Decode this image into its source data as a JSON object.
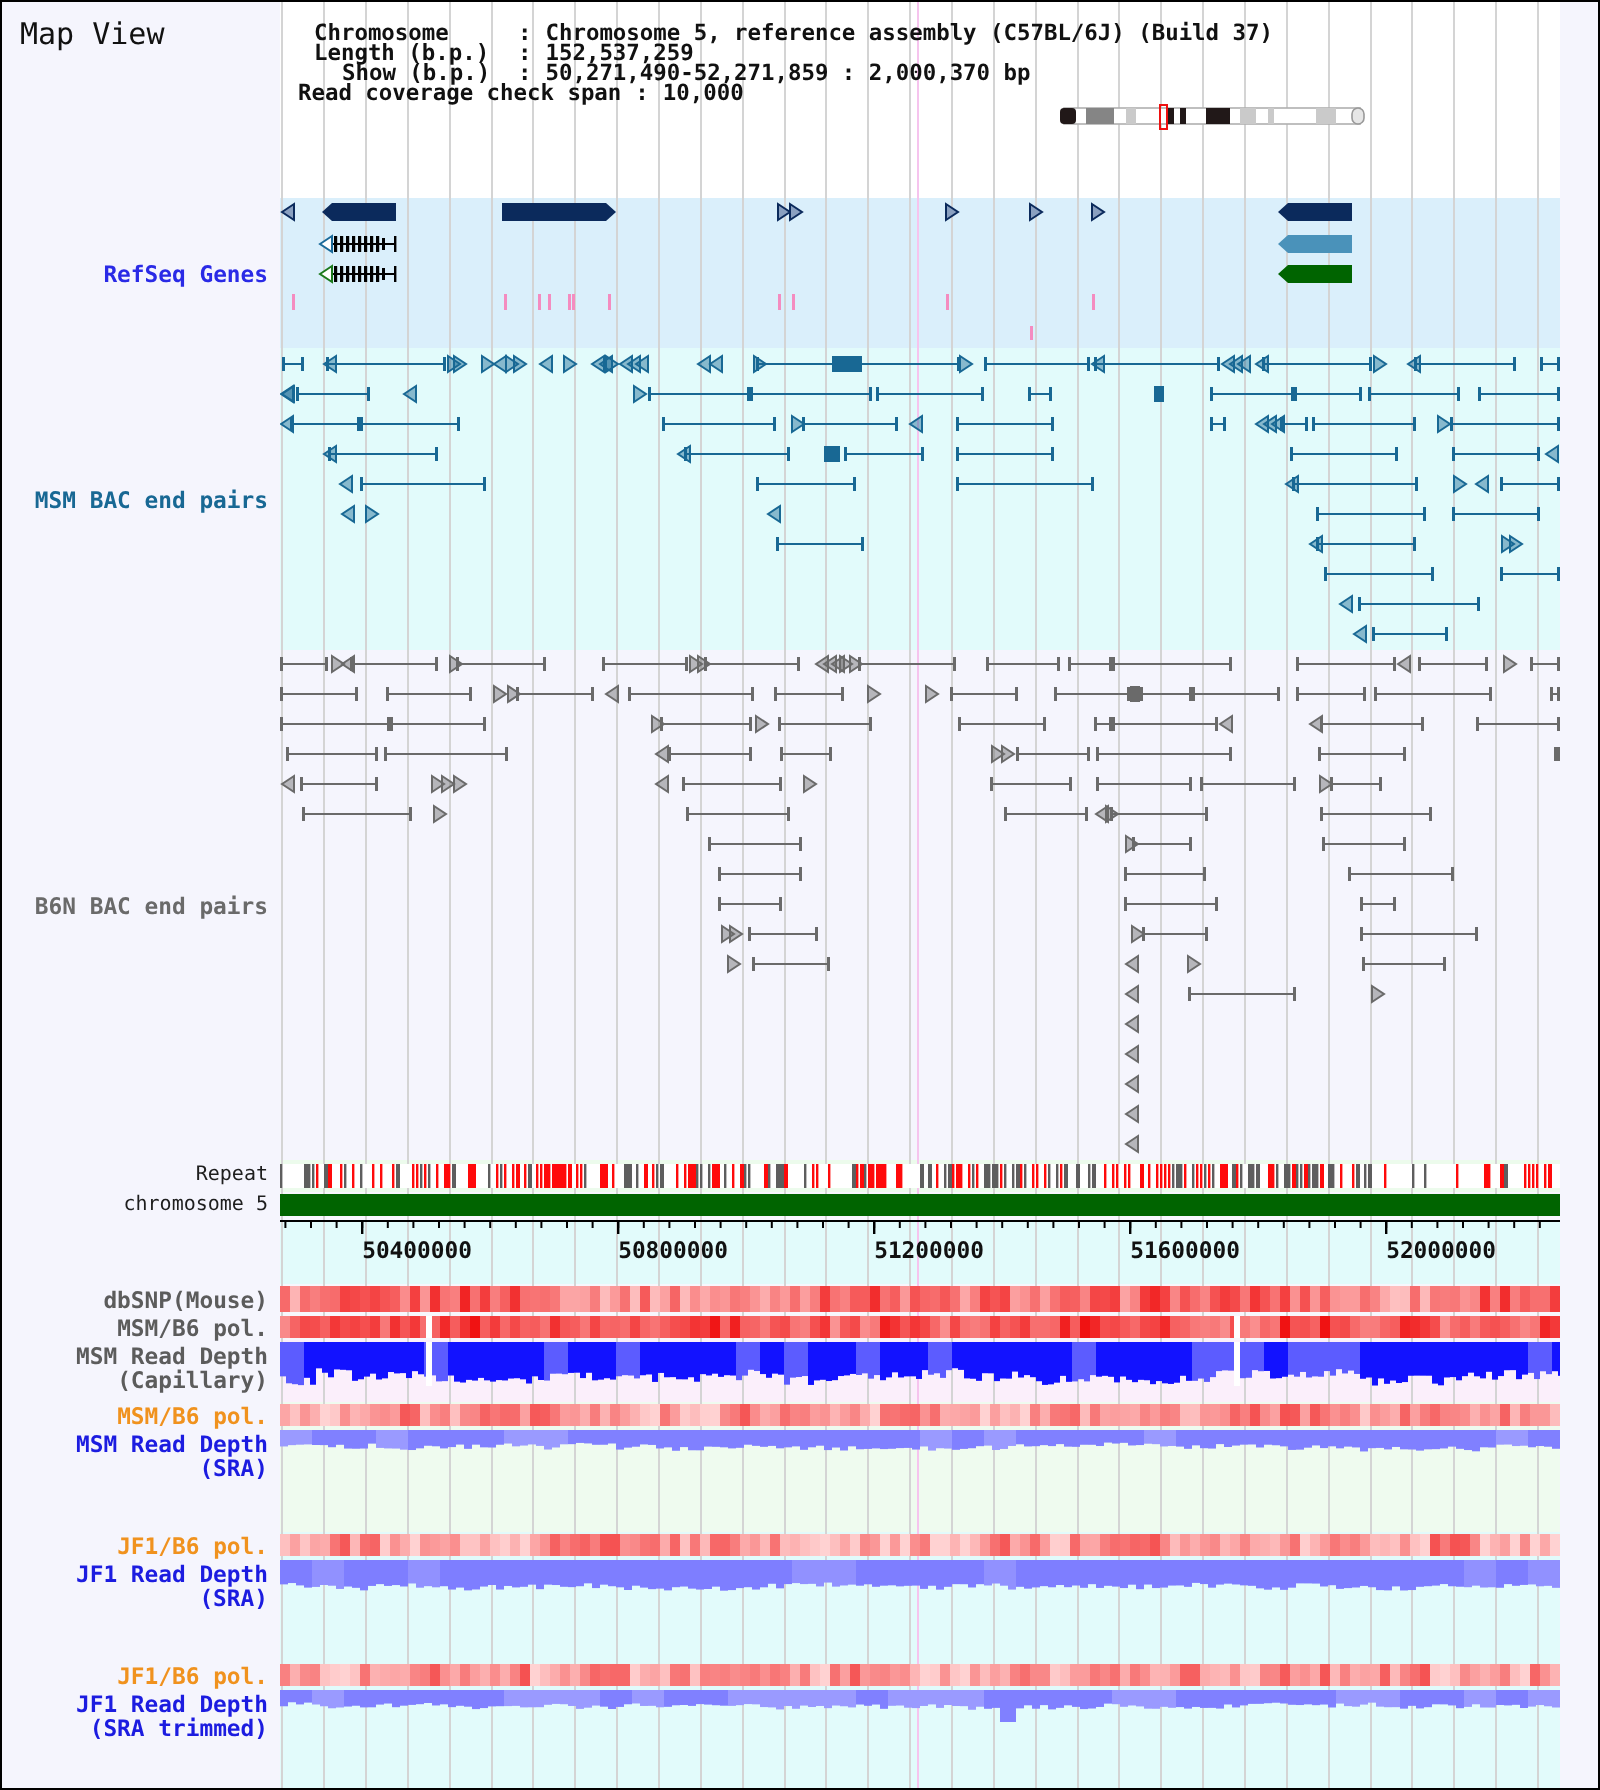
{
  "title": "Map View",
  "info": [
    {
      "label": "Chromosome",
      "separator": ":",
      "value": "Chromosome 5, reference assembly (C57BL/6J) (Build 37)"
    },
    {
      "label": "Length (b.p.)",
      "separator": ":",
      "value": "152,537,259"
    },
    {
      "label": "Show (b.p.)",
      "separator": ":",
      "value": "50,271,490-52,271,859 : 2,000,370 bp"
    },
    {
      "label": "Read coverage check span",
      "separator": ":",
      "value": "10,000"
    }
  ],
  "tracks": [
    {
      "kind": "genes",
      "label": "RefSeq Genes",
      "color": "#2a2ae6"
    },
    {
      "kind": "pairs",
      "label": "MSM BAC end pairs",
      "color": "#186894"
    },
    {
      "kind": "pairs",
      "label": "B6N BAC end pairs",
      "color": "#6a6a6a"
    },
    {
      "kind": "repeat",
      "label": "Repeat",
      "color": "#1e1e1e"
    },
    {
      "kind": "chromosome",
      "label": "chromosome 5",
      "color": "#1e1e1e"
    },
    {
      "kind": "ruler",
      "ticks": [
        "50400000",
        "50800000",
        "51200000",
        "51600000",
        "52000000"
      ]
    },
    {
      "kind": "heat",
      "label": "dbSNP(Mouse)",
      "color": "#5c5c5c"
    },
    {
      "kind": "heat",
      "label": "MSM/B6 pol.",
      "color": "#5c5c5c"
    },
    {
      "kind": "depth",
      "label": "MSM Read Depth (Capillary)",
      "color": "#5c5c5c"
    },
    {
      "kind": "heat",
      "label": "MSM/B6 pol.",
      "color": "#f0921e"
    },
    {
      "kind": "depth",
      "label": "MSM Read Depth (SRA)",
      "color": "#1c1ce0"
    },
    {
      "kind": "heat",
      "label": "JF1/B6 pol.",
      "color": "#f0921e"
    },
    {
      "kind": "depth",
      "label": "JF1 Read Depth (SRA)",
      "color": "#1c1ce0"
    },
    {
      "kind": "heat",
      "label": "JF1/B6 pol.",
      "color": "#f0921e"
    },
    {
      "kind": "depth",
      "label": "JF1 Read Depth (SRA trimmed)",
      "color": "#1c1ce0"
    }
  ]
}
